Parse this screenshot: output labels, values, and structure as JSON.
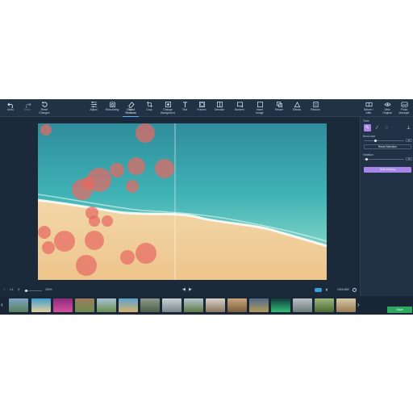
{
  "toolbar": {
    "items": [
      {
        "id": "undo",
        "label": "Undo",
        "icon": "undo-icon"
      },
      {
        "id": "redo",
        "label": "Redo",
        "icon": "redo-icon"
      },
      {
        "id": "reset",
        "label": "Reset\nChanges",
        "icon": "reset-icon"
      },
      {
        "id": "adjust",
        "label": "Adjust",
        "icon": "sliders-icon"
      },
      {
        "id": "retouching",
        "label": "Retouching",
        "icon": "retouch-icon"
      },
      {
        "id": "object_removal",
        "label": "Object\nRemoval",
        "icon": "eraser-icon",
        "active": true
      },
      {
        "id": "crop",
        "label": "Crop",
        "icon": "crop-icon"
      },
      {
        "id": "change_bg",
        "label": "Change\nBackground",
        "icon": "background-icon"
      },
      {
        "id": "text",
        "label": "Text",
        "icon": "text-icon"
      },
      {
        "id": "frames",
        "label": "Frames",
        "icon": "frame-icon"
      },
      {
        "id": "denoise",
        "label": "Denoise",
        "icon": "denoise-icon"
      },
      {
        "id": "borders",
        "label": "Borders",
        "icon": "borders-icon"
      },
      {
        "id": "insert_image",
        "label": "Insert\nImage",
        "icon": "insert-image-icon"
      },
      {
        "id": "resize",
        "label": "Resize",
        "icon": "resize-icon"
      },
      {
        "id": "effects",
        "label": "Effects",
        "icon": "effects-icon"
      },
      {
        "id": "restore",
        "label": "Restore",
        "icon": "restore-icon"
      }
    ],
    "right_items": [
      {
        "id": "before_after",
        "label": "Before /\nAfter",
        "icon": "before-after-icon"
      },
      {
        "id": "view_original",
        "label": "View\nOriginal",
        "icon": "eye-icon"
      },
      {
        "id": "photo_manager",
        "label": "Photo\nManager",
        "icon": "photo-manager-icon"
      }
    ]
  },
  "panel": {
    "tools_label": "Tools",
    "brush_size_label": "Brush size",
    "brush_size_value": "25",
    "reset_selection_label": "Reset Selection",
    "variation_label": "Variation",
    "variation_value": "10",
    "start_erasing_label": "Start Erasing",
    "accent_color": "#a985e8"
  },
  "bottombar": {
    "zoom_value": "100%",
    "image_size": "1024×682",
    "fit_label": "1:1"
  },
  "save_label": "Save",
  "colors": {
    "app_bg": "#1b2a3b",
    "selection_red": "#e66a63",
    "save_green": "#2fa860"
  }
}
